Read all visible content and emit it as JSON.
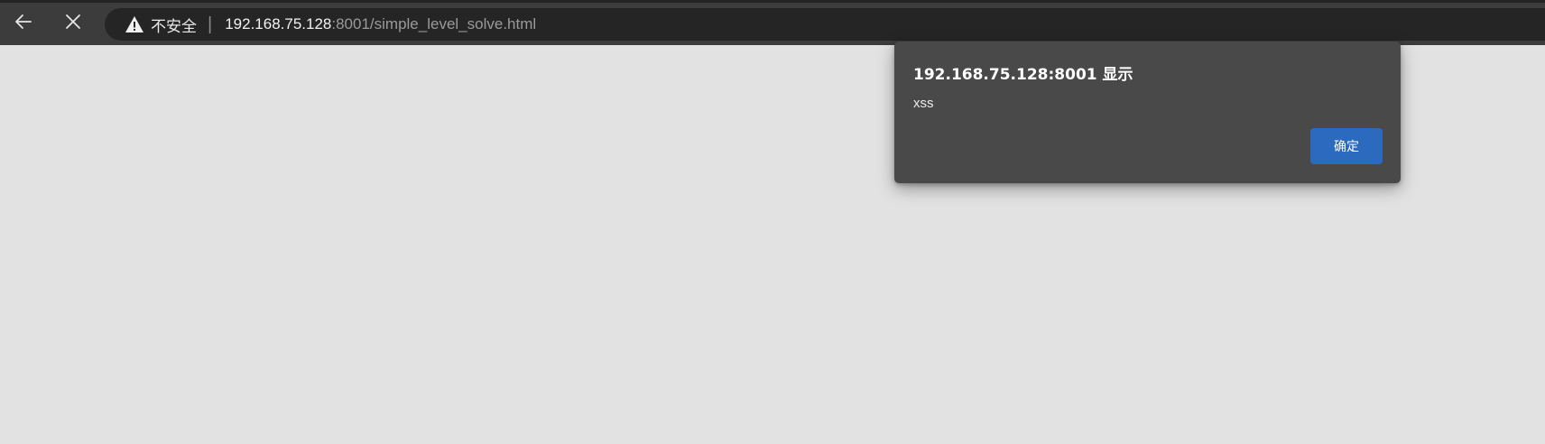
{
  "toolbar": {
    "back_icon": "arrow-left-icon",
    "stop_icon": "close-icon",
    "omnibox": {
      "security_icon": "warning-triangle-icon",
      "security_label": "不安全",
      "separator": "|",
      "url_host": "192.168.75.128",
      "url_rest": ":8001/simple_level_solve.html"
    }
  },
  "alert_dialog": {
    "title": "192.168.75.128:8001 显示",
    "message": "xss",
    "ok_label": "确定"
  },
  "colors": {
    "page_background": "#e2e2e2",
    "toolbar_background": "#3c3c3c",
    "omnibox_background": "#252525",
    "dialog_background": "#494949",
    "button_accent": "#2c6ac0"
  }
}
